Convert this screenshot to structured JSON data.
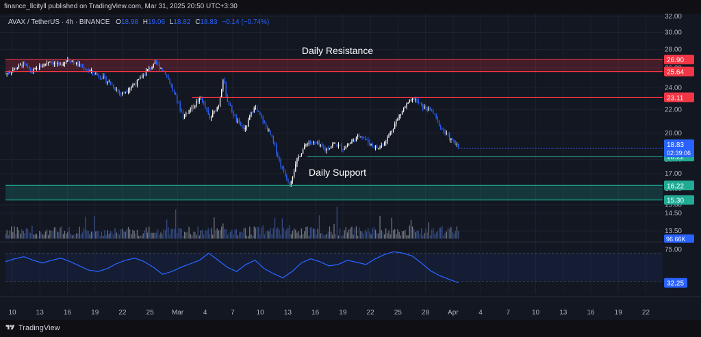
{
  "header": {
    "published_line": "finance_llcityll published on TradingView.com, Mar 31, 2025 20:50 UTC+3:30"
  },
  "footer": {
    "brand": "TradingView"
  },
  "legend": {
    "symbol": "AVAX / TetherUS · 4h · BINANCE",
    "open_label": "O",
    "open": "18.98",
    "high_label": "H",
    "high": "19.06",
    "low_label": "L",
    "low": "18.82",
    "close_label": "C",
    "close": "18.83",
    "change": "−0.14 (−0.74%)"
  },
  "annotations": {
    "resistance": "Daily Resistance",
    "support": "Daily Support"
  },
  "colors": {
    "background": "#131722",
    "up": "#ffffff",
    "down": "#2962ff",
    "resistance": "#f23645",
    "support": "#22ab94",
    "rsi": "#2962ff",
    "grid": "#1e222d",
    "text": "#b2b5be"
  },
  "chart_data": {
    "type": "candlestick",
    "symbol": "AVAX / TetherUS",
    "interval": "4h",
    "exchange": "BINANCE",
    "price_axis_ticks": [
      "32.00",
      "30.00",
      "28.00",
      "26.00",
      "24.00",
      "22.00",
      "20.00",
      "18.00",
      "17.00",
      "16.00",
      "15.00",
      "14.50",
      "13.50"
    ],
    "price_range": [
      13.1,
      32.0
    ],
    "price_scale": "log",
    "x_axis_ticks": [
      "10",
      "13",
      "16",
      "19",
      "22",
      "25",
      "Mar",
      "4",
      "7",
      "10",
      "13",
      "16",
      "19",
      "22",
      "25",
      "28",
      "Apr",
      "4",
      "7",
      "10",
      "13",
      "16",
      "19",
      "22"
    ],
    "x_date_range": [
      "2025-02-08",
      "2025-04-23"
    ],
    "price_path": [
      {
        "x": "2025-02-08",
        "y": 25.4
      },
      {
        "x": "2025-02-10",
        "y": 26.4
      },
      {
        "x": "2025-02-11",
        "y": 25.6
      },
      {
        "x": "2025-02-13",
        "y": 26.8
      },
      {
        "x": "2025-02-14",
        "y": 26.2
      },
      {
        "x": "2025-02-15",
        "y": 27.0
      },
      {
        "x": "2025-02-17",
        "y": 25.9
      },
      {
        "x": "2025-02-19",
        "y": 25.0
      },
      {
        "x": "2025-02-20",
        "y": 24.3
      },
      {
        "x": "2025-02-21",
        "y": 23.4
      },
      {
        "x": "2025-02-23",
        "y": 24.7
      },
      {
        "x": "2025-02-24",
        "y": 25.8
      },
      {
        "x": "2025-02-25",
        "y": 26.5
      },
      {
        "x": "2025-02-26",
        "y": 25.5
      },
      {
        "x": "2025-02-27",
        "y": 23.5
      },
      {
        "x": "2025-02-28",
        "y": 21.4
      },
      {
        "x": "2025-03-01",
        "y": 22.2
      },
      {
        "x": "2025-03-02",
        "y": 23.1
      },
      {
        "x": "2025-03-03",
        "y": 21.2
      },
      {
        "x": "2025-03-04",
        "y": 22.4
      },
      {
        "x": "2025-03-04T12:00",
        "y": 24.9
      },
      {
        "x": "2025-03-05",
        "y": 22.8
      },
      {
        "x": "2025-03-06",
        "y": 21.0
      },
      {
        "x": "2025-03-07",
        "y": 20.3
      },
      {
        "x": "2025-03-08",
        "y": 22.3
      },
      {
        "x": "2025-03-09",
        "y": 21.0
      },
      {
        "x": "2025-03-10",
        "y": 19.6
      },
      {
        "x": "2025-03-11",
        "y": 17.6
      },
      {
        "x": "2025-03-12",
        "y": 16.3
      },
      {
        "x": "2025-03-13",
        "y": 18.2
      },
      {
        "x": "2025-03-14",
        "y": 19.3
      },
      {
        "x": "2025-03-15",
        "y": 19.2
      },
      {
        "x": "2025-03-16",
        "y": 18.7
      },
      {
        "x": "2025-03-17",
        "y": 19.2
      },
      {
        "x": "2025-03-18",
        "y": 18.8
      },
      {
        "x": "2025-03-20",
        "y": 19.9
      },
      {
        "x": "2025-03-21",
        "y": 19.2
      },
      {
        "x": "2025-03-22",
        "y": 18.8
      },
      {
        "x": "2025-03-23",
        "y": 19.6
      },
      {
        "x": "2025-03-24",
        "y": 21.0
      },
      {
        "x": "2025-03-25",
        "y": 22.3
      },
      {
        "x": "2025-03-26",
        "y": 23.0
      },
      {
        "x": "2025-03-27",
        "y": 22.2
      },
      {
        "x": "2025-03-28",
        "y": 21.9
      },
      {
        "x": "2025-03-29",
        "y": 20.5
      },
      {
        "x": "2025-03-30",
        "y": 19.6
      },
      {
        "x": "2025-03-31",
        "y": 18.9
      }
    ],
    "levels": [
      {
        "label": "26.90",
        "value": 26.9,
        "color": "#f23645",
        "kind": "resistance"
      },
      {
        "label": "25.64",
        "value": 25.64,
        "color": "#f23645",
        "kind": "resistance"
      },
      {
        "label": "23.11",
        "value": 23.11,
        "color": "#f23645",
        "kind": "resistance"
      },
      {
        "label": "18.22",
        "value": 18.22,
        "color": "#22ab94",
        "kind": "support"
      },
      {
        "label": "16.22",
        "value": 16.22,
        "color": "#22ab94",
        "kind": "support"
      },
      {
        "label": "15.30",
        "value": 15.3,
        "color": "#22ab94",
        "kind": "support"
      }
    ],
    "zones": [
      {
        "from": 25.64,
        "to": 26.9,
        "color": "#f23645",
        "label": "Daily Resistance"
      },
      {
        "from": 15.3,
        "to": 16.22,
        "color": "#22ab94",
        "label": "Daily Support"
      }
    ],
    "last_price": {
      "value": 18.83,
      "label": "18.83",
      "countdown": "02:39:06",
      "color": "#2962ff"
    },
    "volume": {
      "last_label": "96.66K"
    },
    "rsi": {
      "ticks": [
        "75.00"
      ],
      "last_label": "32.25",
      "band": [
        30,
        70
      ],
      "range": [
        20,
        80
      ],
      "values": [
        58,
        62,
        65,
        60,
        56,
        60,
        63,
        58,
        52,
        46,
        44,
        48,
        55,
        60,
        63,
        58,
        50,
        40,
        44,
        50,
        55,
        60,
        70,
        60,
        50,
        44,
        54,
        60,
        48,
        41,
        35,
        44,
        56,
        62,
        58,
        52,
        54,
        60,
        57,
        54,
        62,
        68,
        72,
        70,
        66,
        56,
        45,
        38,
        33,
        28
      ]
    }
  }
}
